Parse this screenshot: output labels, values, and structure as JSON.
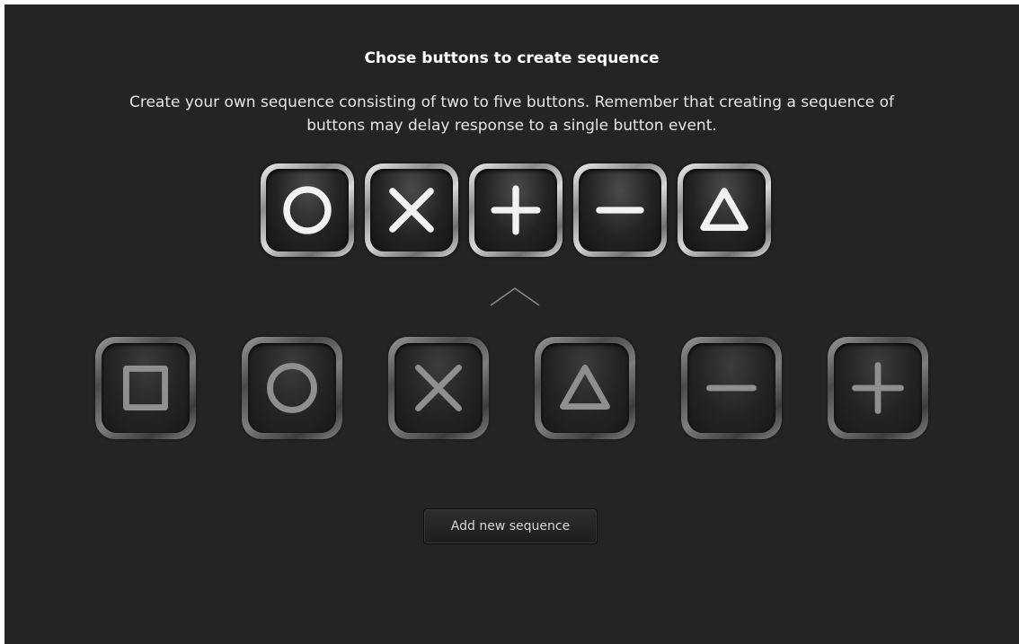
{
  "header": {
    "title": "Chose buttons to create sequence",
    "description_line1": "Create your own sequence consisting of two to five buttons. Remember that creating a sequence of",
    "description_line2": "buttons may delay response to a single button event."
  },
  "sequence": {
    "buttons": [
      "circle",
      "cross",
      "plus",
      "minus",
      "triangle"
    ]
  },
  "choices": {
    "buttons": [
      "square",
      "circle",
      "cross",
      "triangle",
      "minus",
      "plus"
    ]
  },
  "actions": {
    "add_label": "Add new sequence"
  },
  "colors": {
    "background": "#242424",
    "text": "#e6e6e6",
    "title": "#ffffff",
    "glyph_active": "#f2f2f2",
    "glyph_inactive": "#8f8f8f"
  }
}
